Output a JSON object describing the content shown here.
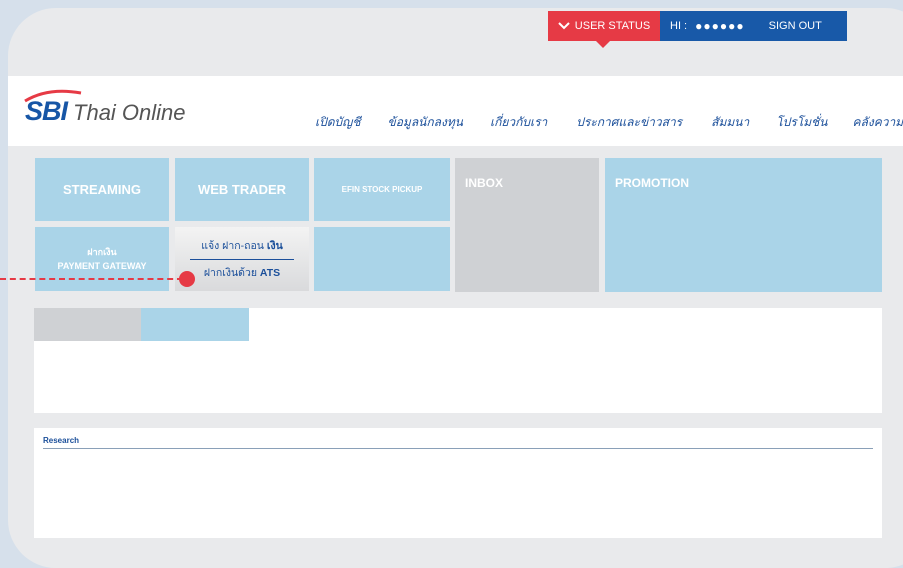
{
  "topbar": {
    "user_status": "USER STATUS",
    "hi_label": "HI :",
    "masked_name": "●●●●●●",
    "sign_out": "SIGN OUT"
  },
  "logo": {
    "brand": "SBI",
    "subtitle": "Thai Online"
  },
  "nav": {
    "items": [
      "เปิดบัญชี",
      "ข้อมูลนักลงทุน",
      "เกี่ยวกับเรา",
      "ประกาศและข่าวสาร",
      "สัมมนา",
      "โปรโมชั่น",
      "คลังความรู้"
    ]
  },
  "tiles": {
    "streaming": "STREAMING",
    "web_trader": "WEB TRADER",
    "efin": "EFIN STOCK PICKUP",
    "inbox": "INBOX",
    "promotion": "PROMOTION",
    "deposit_line1": "ฝากเงิน",
    "deposit_line2": "PAYMENT GATEWAY"
  },
  "ats": {
    "notify_prefix": "แจ้ง ฝาก-ถอน",
    "notify_bold": "เงิน",
    "deposit_prefix": "ฝากเงินด้วย",
    "deposit_bold": "ATS"
  },
  "research": {
    "label": "Research"
  },
  "colors": {
    "accent_red": "#e63a45",
    "brand_blue": "#1859a8",
    "tile_blue": "#aad4e8",
    "tile_gray": "#cfd1d4"
  }
}
